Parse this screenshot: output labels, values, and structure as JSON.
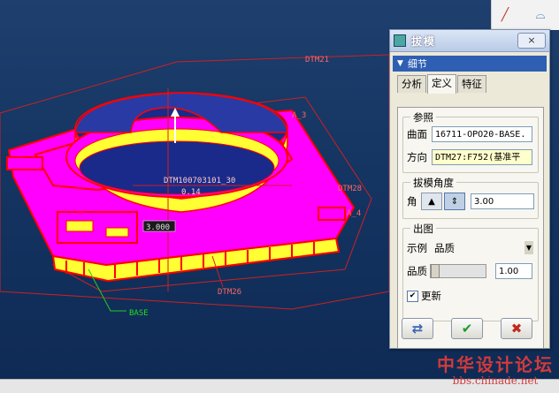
{
  "viewport": {
    "labels": {
      "dtm21": "DTM21",
      "dtm28": "DTM28",
      "dtm26": "DTM26",
      "a4": "A_4",
      "a3": "A_3",
      "base": "BASE",
      "datum_note": "DTM100703101_30",
      "dim_value": "3.000",
      "dim_small": "0.14"
    }
  },
  "toolbar": {
    "icons": [
      "edge-tool-icon",
      "note-icon"
    ]
  },
  "dialog": {
    "title": "拔模",
    "close": "×",
    "section": "细节",
    "tabs": [
      "分析",
      "定义",
      "特征"
    ],
    "active_tab": "定义",
    "reference": {
      "group": "参照",
      "surface_label": "曲面",
      "surface_value": "16711-OPO20-BASE.",
      "direction_label": "方向",
      "direction_value": "DTM27:F752(基准平"
    },
    "draft": {
      "group": "拔模角度",
      "angle_label": "角",
      "angle_value": "3.00"
    },
    "output": {
      "group": "出图",
      "example_label": "示例",
      "example_value": "品质",
      "quality_label": "品质",
      "quality_value": "1.00",
      "quality_level": 0.0,
      "update_label": "更新",
      "update_checked": true
    }
  },
  "watermark": {
    "title": "中华设计论坛",
    "url": "bbs.chinade.net"
  },
  "colors": {
    "accent": "#2e5fb3",
    "part": "#ff00ff",
    "edges": "#ff0000",
    "face": "#1a2a8a",
    "wall": "#ffff33"
  }
}
